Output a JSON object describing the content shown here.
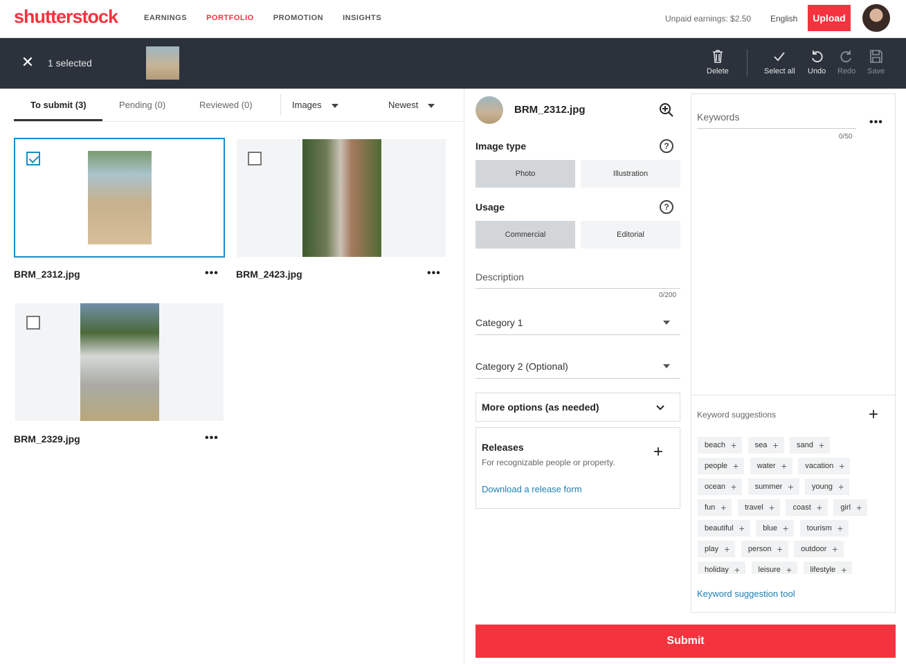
{
  "brand": {
    "logo_text": "shutterstock",
    "accent": "#f5333f"
  },
  "nav": {
    "items": [
      "EARNINGS",
      "PORTFOLIO",
      "PROMOTION",
      "INSIGHTS"
    ],
    "active": "PORTFOLIO"
  },
  "header": {
    "unpaid": "Unpaid earnings: $2.50",
    "language": "English",
    "upload_label": "Upload"
  },
  "selection_bar": {
    "count_label": "1 selected",
    "tools": {
      "delete": "Delete",
      "select_all": "Select all",
      "undo": "Undo",
      "redo": "Redo",
      "save": "Save"
    }
  },
  "tabs": {
    "to_submit": "To submit (3)",
    "pending": "Pending (0)",
    "reviewed": "Reviewed (0)",
    "type_filter": "Images",
    "sort": "Newest"
  },
  "images": [
    {
      "file": "BRM_2312.jpg",
      "selected": true
    },
    {
      "file": "BRM_2423.jpg",
      "selected": false
    },
    {
      "file": "BRM_2329.jpg",
      "selected": false
    }
  ],
  "details": {
    "file": "BRM_2312.jpg",
    "image_type_title": "Image type",
    "image_type_options": [
      "Photo",
      "Illustration"
    ],
    "image_type_selected": "Photo",
    "usage_title": "Usage",
    "usage_options": [
      "Commercial",
      "Editorial"
    ],
    "usage_selected": "Commercial",
    "description_placeholder": "Description",
    "description_count": "0/200",
    "category1": "Category 1",
    "category2": "Category 2 (Optional)",
    "more_options": "More options (as needed)",
    "releases_title": "Releases",
    "releases_sub": "For recognizable people or property.",
    "release_link": "Download a release form"
  },
  "keywords": {
    "placeholder": "Keywords",
    "count": "0/50",
    "suggestions_title": "Keyword suggestions",
    "suggestions": [
      "beach",
      "sea",
      "sand",
      "people",
      "water",
      "vacation",
      "ocean",
      "summer",
      "young",
      "fun",
      "travel",
      "coast",
      "girl",
      "beautiful",
      "blue",
      "tourism",
      "play",
      "person",
      "outdoor",
      "holiday",
      "leisure",
      "lifestyle"
    ],
    "tool_link": "Keyword suggestion tool"
  },
  "submit_label": "Submit"
}
